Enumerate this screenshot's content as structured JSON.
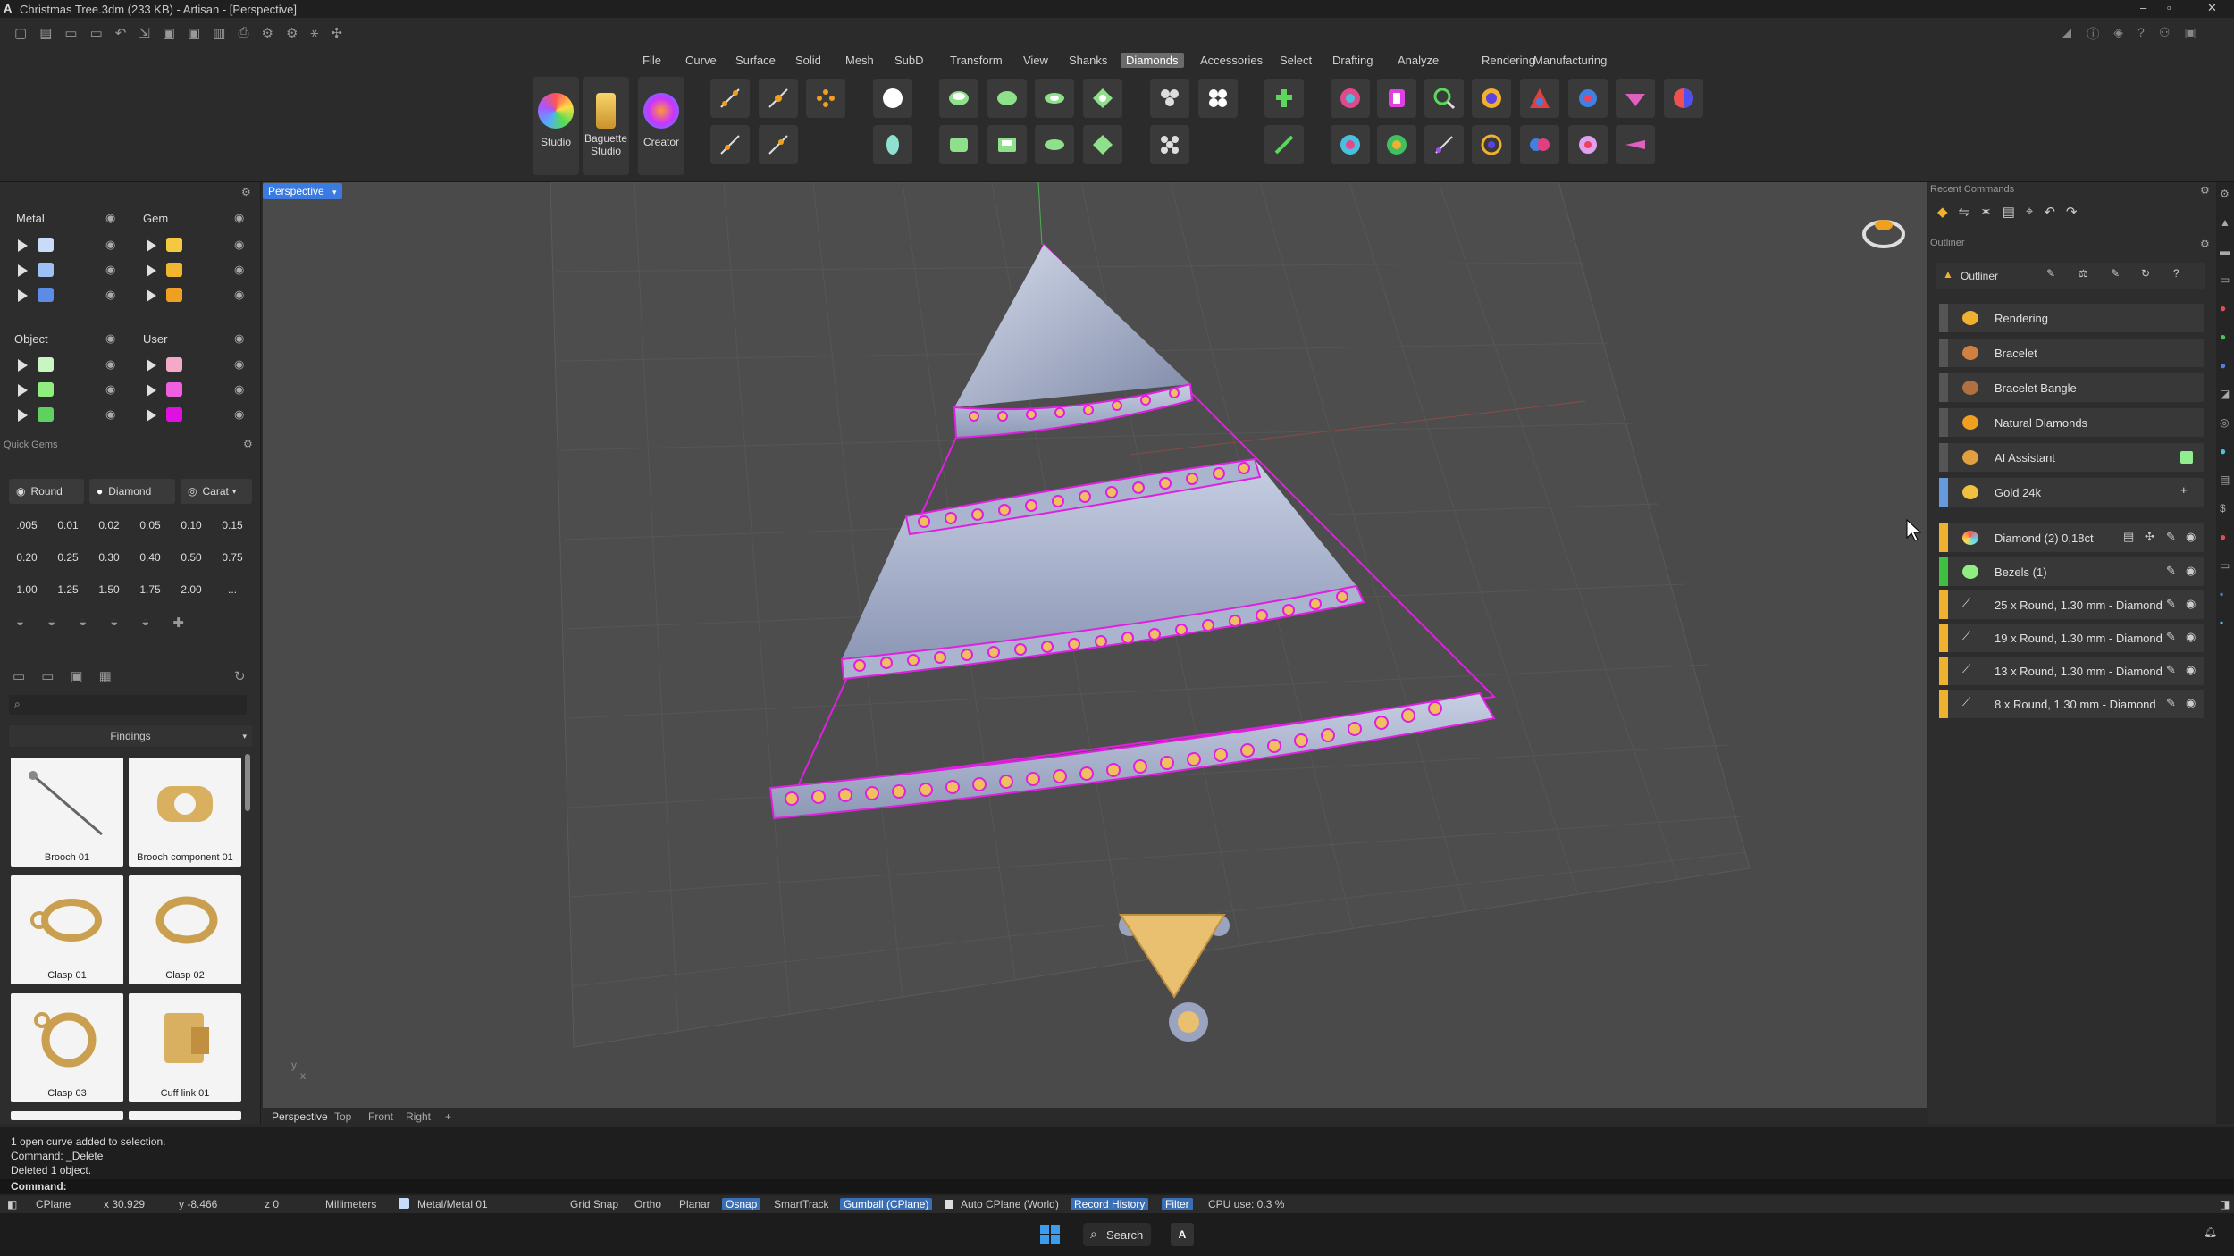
{
  "window": {
    "title": "Christmas Tree.3dm (233 KB) - Artisan - [Perspective]"
  },
  "menus": [
    "File",
    "Curve",
    "Surface",
    "Solid",
    "Mesh",
    "SubD",
    "Transform",
    "View",
    "Shanks",
    "Diamonds",
    "Accessories",
    "Select",
    "Drafting",
    "Analyze",
    "Rendering",
    "Manufacturing"
  ],
  "active_menu": "Diamonds",
  "ribbon": {
    "studio": "Studio",
    "baguette": "Baguette Studio",
    "creator": "Creator"
  },
  "layers": {
    "metal": "Metal",
    "gem": "Gem",
    "object": "Object",
    "user": "User",
    "metal_colors": [
      "#9ec1f5",
      "#8ab3f2",
      "#5b8de6"
    ],
    "gem_colors": [
      "#f5c842",
      "#f0b630",
      "#f0a020"
    ],
    "object_colors": [
      "#b8f0b0",
      "#90ee80",
      "#60d060"
    ],
    "user_colors": [
      "#f5a8c8",
      "#ee60e0",
      "#e010e0"
    ]
  },
  "quick_gems": {
    "title": "Quick Gems",
    "shape": "Round",
    "material": "Diamond",
    "unit": "Carat",
    "sizes": [
      ".005",
      "0.01",
      "0.02",
      "0.05",
      "0.10",
      "0.15",
      "0.20",
      "0.25",
      "0.30",
      "0.40",
      "0.50",
      "0.75",
      "1.00",
      "1.25",
      "1.50",
      "1.75",
      "2.00",
      "..."
    ]
  },
  "findings": {
    "header": "Findings",
    "items": [
      "Brooch 01",
      "Brooch component 01",
      "Clasp 01",
      "Clasp 02",
      "Clasp 03",
      "Cuff link 01"
    ]
  },
  "viewport": {
    "label": "Perspective",
    "tabs": [
      "Perspective",
      "Top",
      "Front",
      "Right",
      "+"
    ]
  },
  "right": {
    "recent_commands": "Recent Commands",
    "outliner_title": "Outliner",
    "outliner_header": "Outliner",
    "materials": [
      "Rendering",
      "Bracelet",
      "Bracelet Bangle",
      "Natural Diamonds",
      "AI Assistant",
      "Gold 24k"
    ],
    "objects": [
      "Diamond (2) 0,18ct",
      "Bezels (1)",
      "25 x Round, 1.30 mm - Diamond",
      "19 x Round, 1.30 mm - Diamond",
      "13 x Round, 1.30 mm - Diamond",
      "8 x Round, 1.30 mm - Diamond"
    ]
  },
  "command": {
    "history": [
      "1 open curve added to selection.",
      "Command: _Delete",
      "Deleted 1 object."
    ],
    "prompt": "Command:"
  },
  "status": {
    "cplane": "CPlane",
    "x": "x 30.929",
    "y": "y -8.466",
    "z": "z 0",
    "units": "Millimeters",
    "layer": "Metal/Metal 01",
    "grid_snap": "Grid Snap",
    "ortho": "Ortho",
    "planar": "Planar",
    "osnap": "Osnap",
    "smarttrack": "SmartTrack",
    "gumball": "Gumball (CPlane)",
    "auto_cplane": "Auto CPlane (World)",
    "record_history": "Record History",
    "filter": "Filter",
    "cpu": "CPU use: 0.3 %"
  },
  "taskbar": {
    "search": "Search"
  }
}
